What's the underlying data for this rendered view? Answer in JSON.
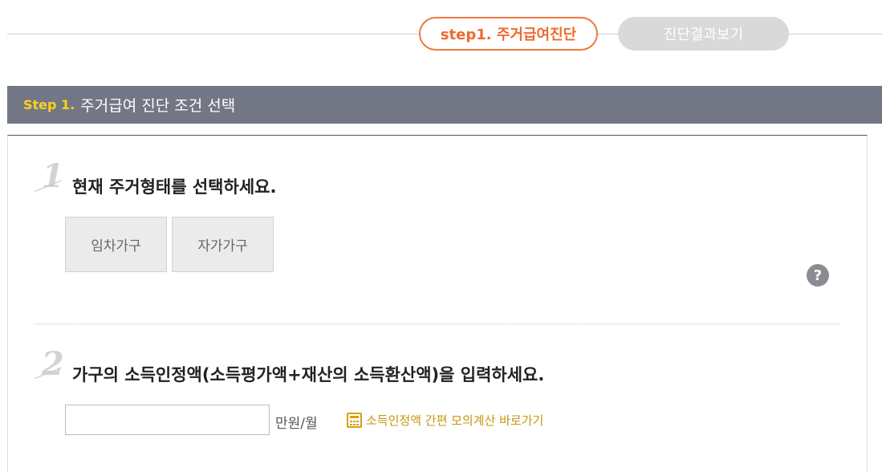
{
  "steps": {
    "active_label": "step1. 주거급여진단",
    "inactive_label": "진단결과보기"
  },
  "section": {
    "step_label": "Step 1.",
    "title": "주거급여 진단 조건 선택"
  },
  "question1": {
    "number": "1",
    "text": "현재 주거형태를 선택하세요.",
    "options": [
      "임차가구",
      "자가가구"
    ],
    "help_icon": "?"
  },
  "question2": {
    "number": "2",
    "text": "가구의 소득인정액(소득평가액+재산의 소득환산액)을 입력하세요.",
    "input_value": "",
    "unit": "만원/월",
    "calc_link": "소득인정액 간편 모의계산 바로가기"
  },
  "colors": {
    "accent_orange": "#ef7840",
    "section_bar": "#737785",
    "step_yellow": "#ffd21a",
    "link_gold": "#c99512"
  }
}
